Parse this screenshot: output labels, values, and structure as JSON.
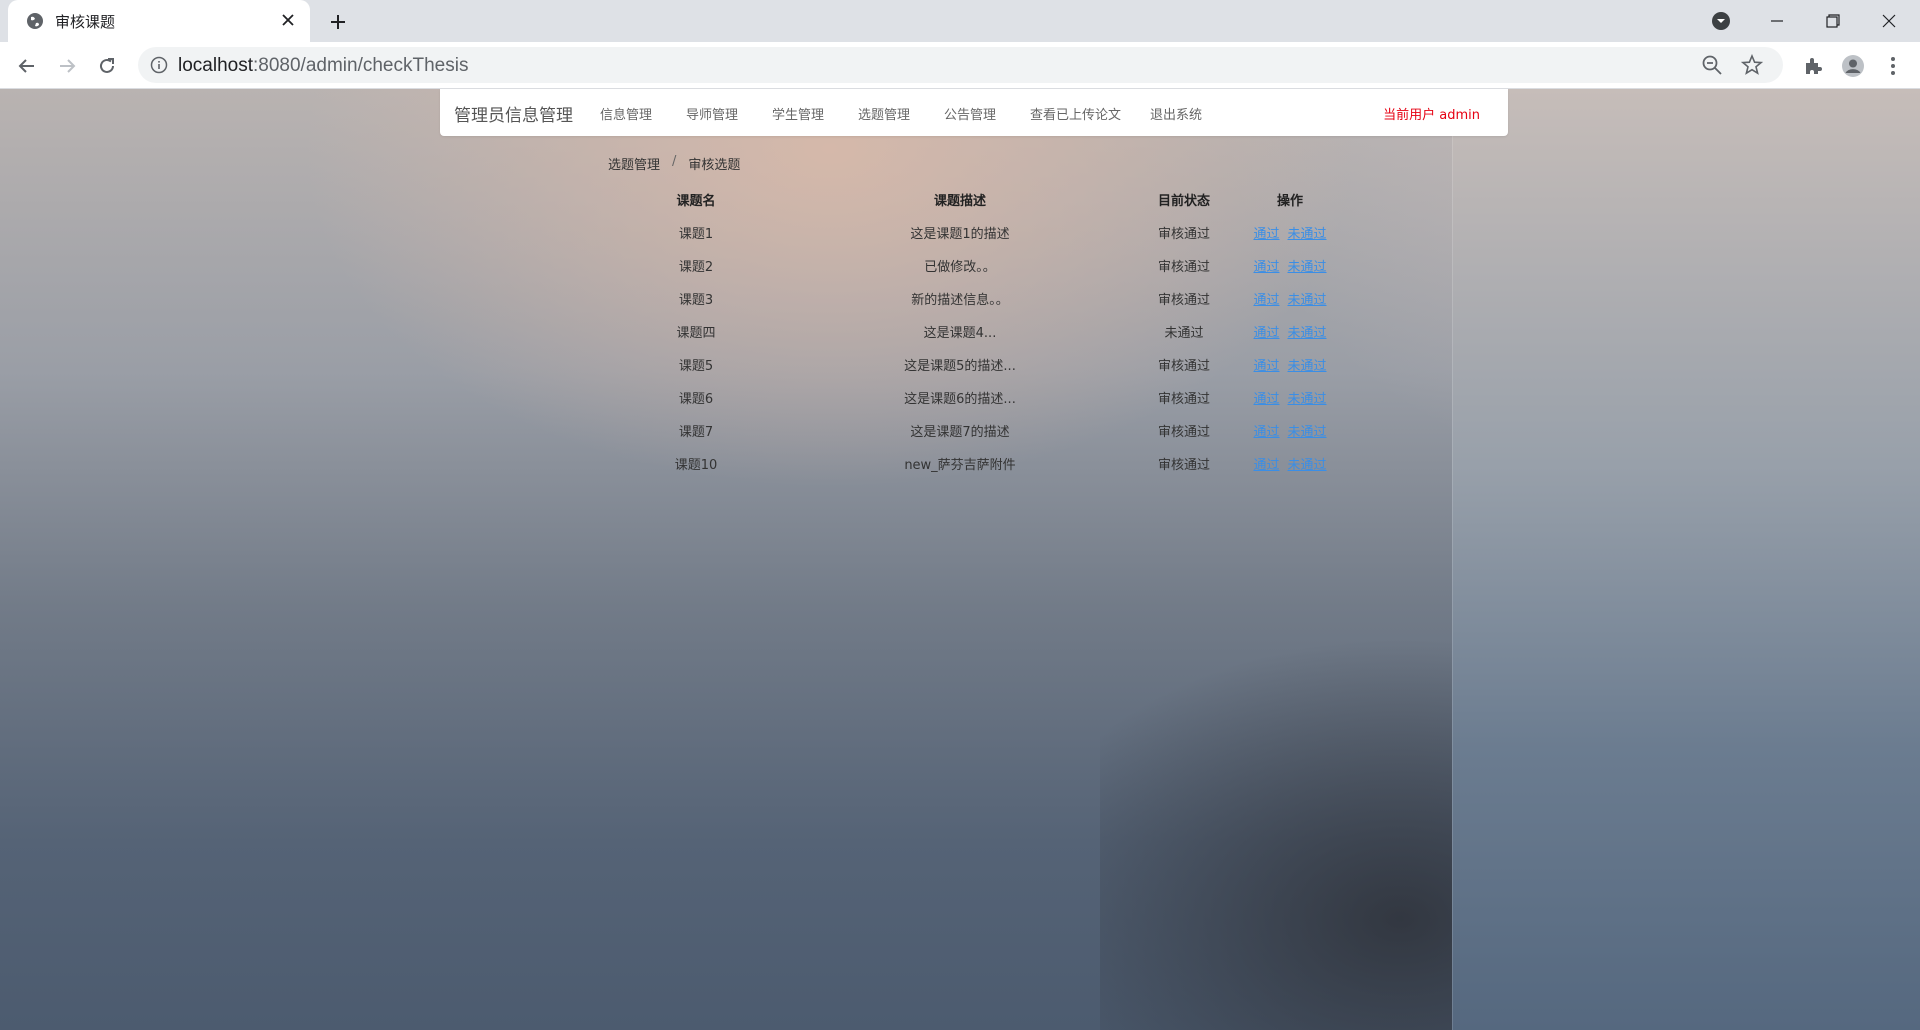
{
  "browser": {
    "tab_title": "审核课题",
    "url_host": "localhost",
    "url_rest": ":8080/admin/checkThesis"
  },
  "navbar": {
    "brand": "管理员信息管理",
    "menu": [
      "信息管理",
      "导师管理",
      "学生管理",
      "选题管理",
      "公告管理",
      "查看已上传论文",
      "退出系统"
    ],
    "current_user": "当前用户 admin"
  },
  "breadcrumb": {
    "parent": "选题管理",
    "separator": "/",
    "current": "审核选题"
  },
  "table": {
    "headers": [
      "课题名",
      "课题描述",
      "目前状态",
      "操作"
    ],
    "pass_label": "通过",
    "fail_label": "未通过",
    "rows": [
      {
        "name": "课题1",
        "desc": "这是课题1的描述",
        "status": "审核通过"
      },
      {
        "name": "课题2",
        "desc": "已做修改。。",
        "status": "审核通过"
      },
      {
        "name": "课题3",
        "desc": "新的描述信息。。",
        "status": "审核通过"
      },
      {
        "name": "课题四",
        "desc": "这是课题4...",
        "status": "未通过"
      },
      {
        "name": "课题5",
        "desc": "这是课题5的描述...",
        "status": "审核通过"
      },
      {
        "name": "课题6",
        "desc": "这是课题6的描述...",
        "status": "审核通过"
      },
      {
        "name": "课题7",
        "desc": "这是课题7的描述",
        "status": "审核通过"
      },
      {
        "name": "课题10",
        "desc": "new_萨芬吉萨附件",
        "status": "审核通过"
      }
    ]
  },
  "colors": {
    "link": "#3a8ee6",
    "current_user": "#e60012"
  }
}
